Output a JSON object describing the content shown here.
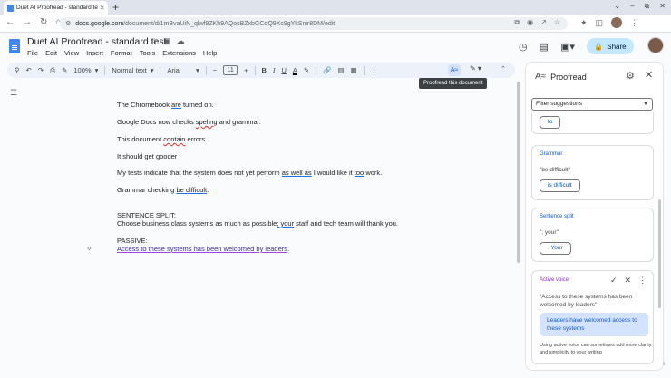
{
  "browser": {
    "tab_title": "Duet AI Proofread - standard te…",
    "tab_close": "×",
    "new_tab": "+",
    "url_host": "docs.google.com",
    "url_path": "/document/d/1mBvaUiN_qlwf9ZKh9AQosBZxbGCdQ9Xc9gYkSnir8DM/edit",
    "window_controls": [
      "⌄",
      "–",
      "⧉",
      "✕"
    ],
    "nav_icons": [
      "←",
      "→",
      "↻",
      "⌂"
    ]
  },
  "doc": {
    "title": "Duet AI Proofread - standard test",
    "menu": [
      "File",
      "Edit",
      "View",
      "Insert",
      "Format",
      "Tools",
      "Extensions",
      "Help"
    ],
    "share_label": "Share"
  },
  "toolbar": {
    "zoom": "100%",
    "style": "Normal text",
    "font": "Arial",
    "font_size": "11",
    "minus": "−",
    "plus": "+",
    "bold": "B",
    "italic": "I",
    "underline": "U",
    "text_color": "A",
    "tooltip": "Proofread this document"
  },
  "body": {
    "l1_a": "The Chromebook ",
    "l1_err": "are",
    "l1_b": " turned on.",
    "l2_a": "Google Docs now checks ",
    "l2_err": "speling",
    "l2_b": " and grammar.",
    "l3_a": "This document ",
    "l3_err": "contain",
    "l3_b": " errors.",
    "l4": "It should get gooder",
    "l5_a": "My tests indicate that the system does not yet perform ",
    "l5_err": "as well as",
    "l5_b": " I would like it ",
    "l5_err2": "too",
    "l5_c": " work.",
    "l6_a": "Grammar checking ",
    "l6_err": "be difficult",
    "l6_b": ".",
    "l7": "SENTENCE SPLIT:",
    "l8_a": "Choose business class systems as much as possible",
    "l8_err": "; your",
    "l8_b": " staff and tech team will thank you.",
    "l9": "PASSIVE:",
    "l10": "Access to these systems has been welcomed by leaders"
  },
  "panel": {
    "title": "Proofread",
    "filter": "Filter suggestions",
    "card0_chip": "to",
    "card1_label": "Grammar",
    "card1_quote": "be difficult",
    "card1_chip": "is difficult",
    "card2_label": "Sentence split",
    "card2_quote": "\"; your\"",
    "card2_chip": ". Your",
    "card3_label": "Active voice",
    "card3_quote": "\"Access to these systems has been welcomed by leaders\"",
    "card3_accept": "Leaders have welcomed access to these systems",
    "card3_note": "Using active voice can sometimes add more clarity and simplicity to your writing"
  }
}
